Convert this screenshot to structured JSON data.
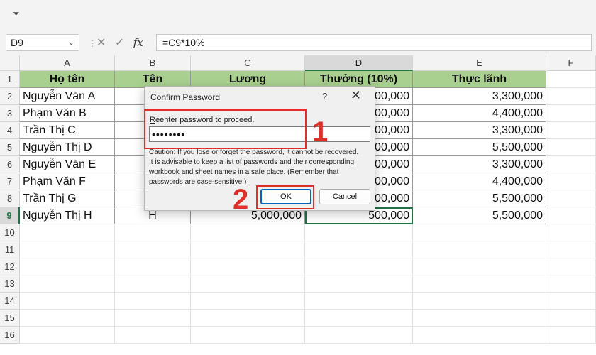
{
  "toolbar": {
    "quick_access_icon": "chevron-down-icon"
  },
  "formula_bar": {
    "name_box": "D9",
    "cancel_icon": "x-icon",
    "enter_icon": "check-icon",
    "fx_label": "fx",
    "formula": "=C9*10%"
  },
  "columns": [
    "A",
    "B",
    "C",
    "D",
    "E",
    "F"
  ],
  "rows": [
    "1",
    "2",
    "3",
    "4",
    "5",
    "6",
    "7",
    "8",
    "9",
    "10",
    "11",
    "12",
    "13",
    "14",
    "15",
    "16"
  ],
  "table": {
    "headers": [
      "Họ tên",
      "Tên",
      "Lương",
      "Thưởng (10%)",
      "Thực lãnh"
    ],
    "rows": [
      [
        "Nguyễn Văn A",
        "",
        "",
        "300,000",
        "3,300,000"
      ],
      [
        "Phạm Văn B",
        "",
        "",
        "400,000",
        "4,400,000"
      ],
      [
        "Trần Thị C",
        "",
        "",
        "300,000",
        "3,300,000"
      ],
      [
        "Nguyễn Thị D",
        "",
        "",
        "500,000",
        "5,500,000"
      ],
      [
        "Nguyễn Văn E",
        "",
        "",
        "300,000",
        "3,300,000"
      ],
      [
        "Phạm Văn F",
        "",
        "",
        "400,000",
        "4,400,000"
      ],
      [
        "Trần Thị G",
        "",
        "",
        "500,000",
        "5,500,000"
      ],
      [
        "Nguyễn Thị H",
        "H",
        "5,000,000",
        "500,000",
        "5,500,000"
      ]
    ]
  },
  "dialog": {
    "title": "Confirm Password",
    "help": "?",
    "close": "✕",
    "prompt_first": "R",
    "prompt_rest": "eenter password to proceed.",
    "password": "••••••••",
    "caution": "Caution: If you lose or forget the password, it cannot be recovered. It is advisable to keep a list of passwords and their corresponding workbook and sheet names in a safe place. (Remember that passwords are case-sensitive.)",
    "ok_label": "OK",
    "cancel_label": "Cancel"
  },
  "annotations": {
    "marker1": "1",
    "marker2": "2",
    "color": "#e0302a"
  },
  "colors": {
    "header_fill": "#a9d08e",
    "excel_green": "#217346",
    "ok_border": "#0067c0"
  }
}
